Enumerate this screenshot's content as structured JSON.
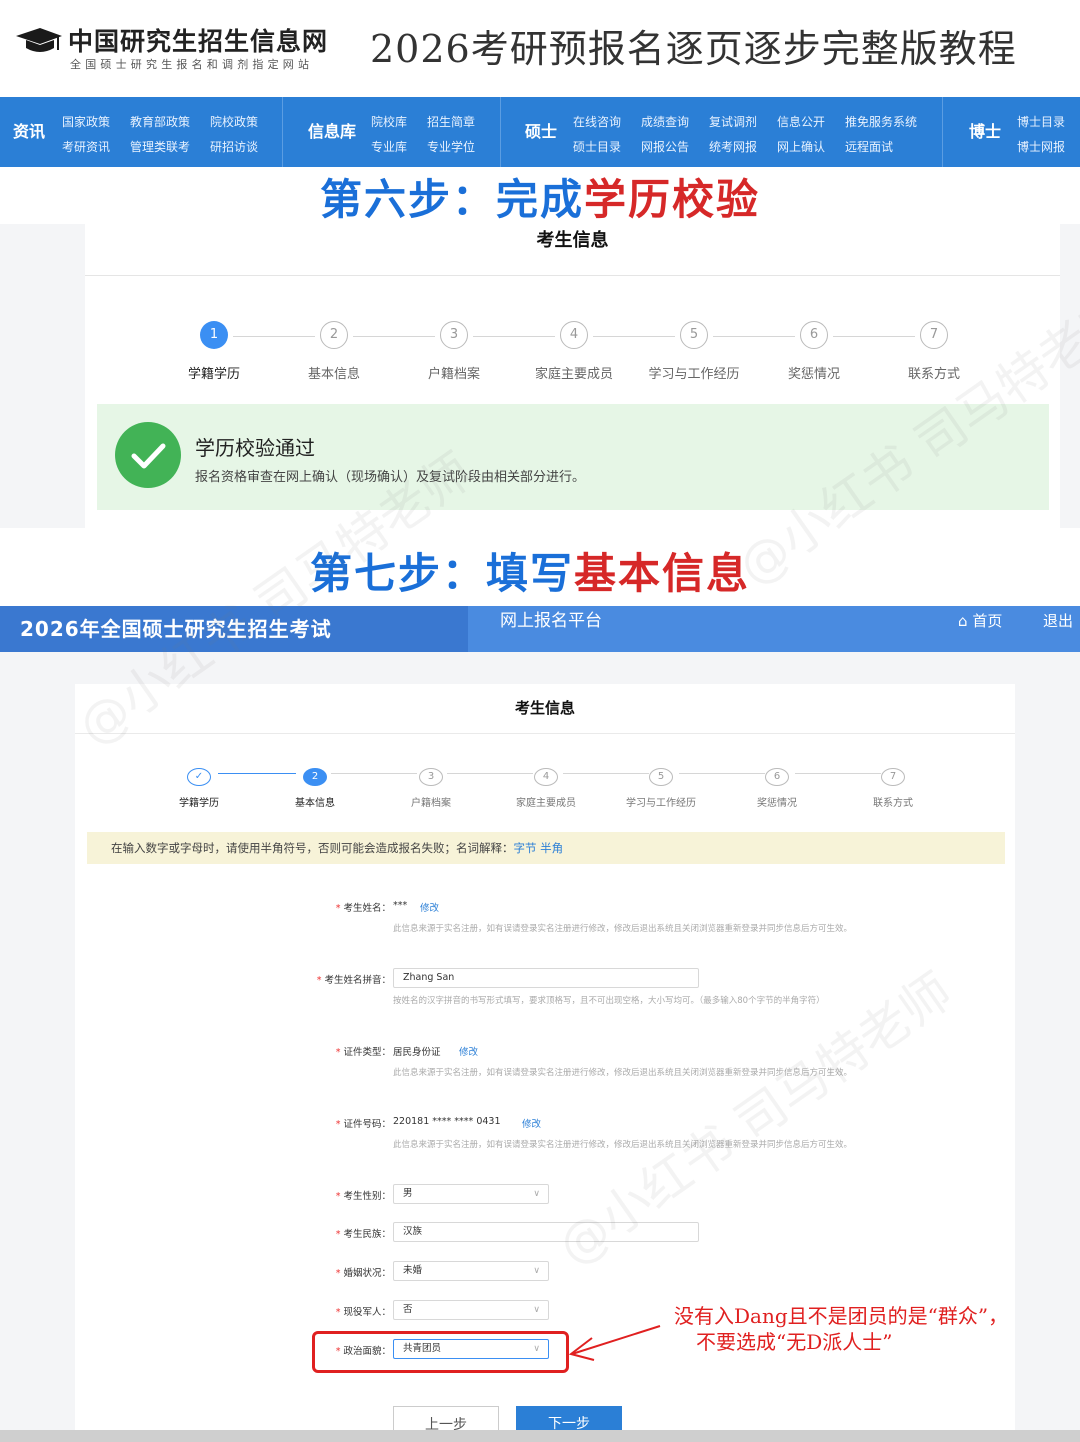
{
  "header": {
    "logo_main": "中国研究生招生信息网",
    "logo_sub": "全国硕士研究生报名和调剂指定网站",
    "title": "2026考研预报名逐页逐步完整版教程"
  },
  "nav": {
    "categories": [
      {
        "label": "资讯",
        "links": [
          "国家政策",
          "教育部政策",
          "院校政策",
          "考研资讯",
          "管理类联考",
          "研招访谈"
        ]
      },
      {
        "label": "信息库",
        "links": [
          "院校库",
          "招生简章",
          "专业库",
          "专业学位"
        ]
      },
      {
        "label": "硕士",
        "links": [
          "在线咨询",
          "成绩查询",
          "复试调剂",
          "信息公开",
          "推免服务系统",
          "硕士目录",
          "网报公告",
          "统考网报",
          "网上确认",
          "远程面试"
        ]
      },
      {
        "label": "博士",
        "links": [
          "博士目录",
          "博士网报"
        ]
      }
    ]
  },
  "step6": {
    "prefix": "第六步：",
    "blue": "完成",
    "red": "学历校验"
  },
  "panel1": {
    "title": "考生信息",
    "steps": [
      {
        "num": "1",
        "label": "学籍学历"
      },
      {
        "num": "2",
        "label": "基本信息"
      },
      {
        "num": "3",
        "label": "户籍档案"
      },
      {
        "num": "4",
        "label": "家庭主要成员"
      },
      {
        "num": "5",
        "label": "学习与工作经历"
      },
      {
        "num": "6",
        "label": "奖惩情况"
      },
      {
        "num": "7",
        "label": "联系方式"
      }
    ],
    "success_title": "学历校验通过",
    "success_desc": "报名资格审查在网上确认（现场确认）及复试阶段由相关部分进行。"
  },
  "step7": {
    "prefix": "第七步：",
    "blue": "填写",
    "red": "基本信息"
  },
  "topbar": {
    "left": "2026年全国硕士研究生招生考试",
    "mid": "网上报名平台",
    "home": "首页",
    "exit": "退出"
  },
  "panel2": {
    "title": "考生信息",
    "steps": [
      {
        "num": "✓",
        "label": "学籍学历"
      },
      {
        "num": "2",
        "label": "基本信息"
      },
      {
        "num": "3",
        "label": "户籍档案"
      },
      {
        "num": "4",
        "label": "家庭主要成员"
      },
      {
        "num": "5",
        "label": "学习与工作经历"
      },
      {
        "num": "6",
        "label": "奖惩情况"
      },
      {
        "num": "7",
        "label": "联系方式"
      }
    ],
    "notice": "在输入数字或字母时，请使用半角符号，否则可能会造成报名失败；名词解释：",
    "notice_link1": "字节",
    "notice_link2": "半角",
    "edit": "修改",
    "fields": {
      "name_label": "考生姓名：",
      "name_value": "***",
      "hint_realname": "此信息来源于实名注册，如有误请登录实名注册进行修改，修改后退出系统且关闭浏览器重新登录并同步信息后方可生效。",
      "pinyin_label": "考生姓名拼音：",
      "pinyin_value": "Zhang San",
      "pinyin_hint": "按姓名的汉字拼音的书写形式填写，要求顶格写，且不可出现空格，大小写均可。（最多输入80个字节的半角字符）",
      "idtype_label": "证件类型：",
      "idtype_value": "居民身份证",
      "idno_label": "证件号码：",
      "idno_value": "220181 **** **** 0431",
      "gender_label": "考生性别：",
      "gender_value": "男",
      "ethnic_label": "考生民族：",
      "ethnic_value": "汉族",
      "marital_label": "婚姻状况：",
      "marital_value": "未婚",
      "military_label": "现役军人：",
      "military_value": "否",
      "political_label": "政治面貌：",
      "political_value": "共青团员"
    },
    "btn_prev": "上一步",
    "btn_next": "下一步"
  },
  "annotation": {
    "line1": "没有入Dang且不是团员的是“群众”，",
    "line2": "不要选成“无D派人士”"
  },
  "watermark": "@小红书 司马特老师",
  "colors": {
    "nav_blue": "#2b7fd6",
    "heading_blue": "#1a6fd8",
    "heading_red": "#d62828",
    "success_green": "#42b356",
    "annotation_red": "#e02020"
  }
}
